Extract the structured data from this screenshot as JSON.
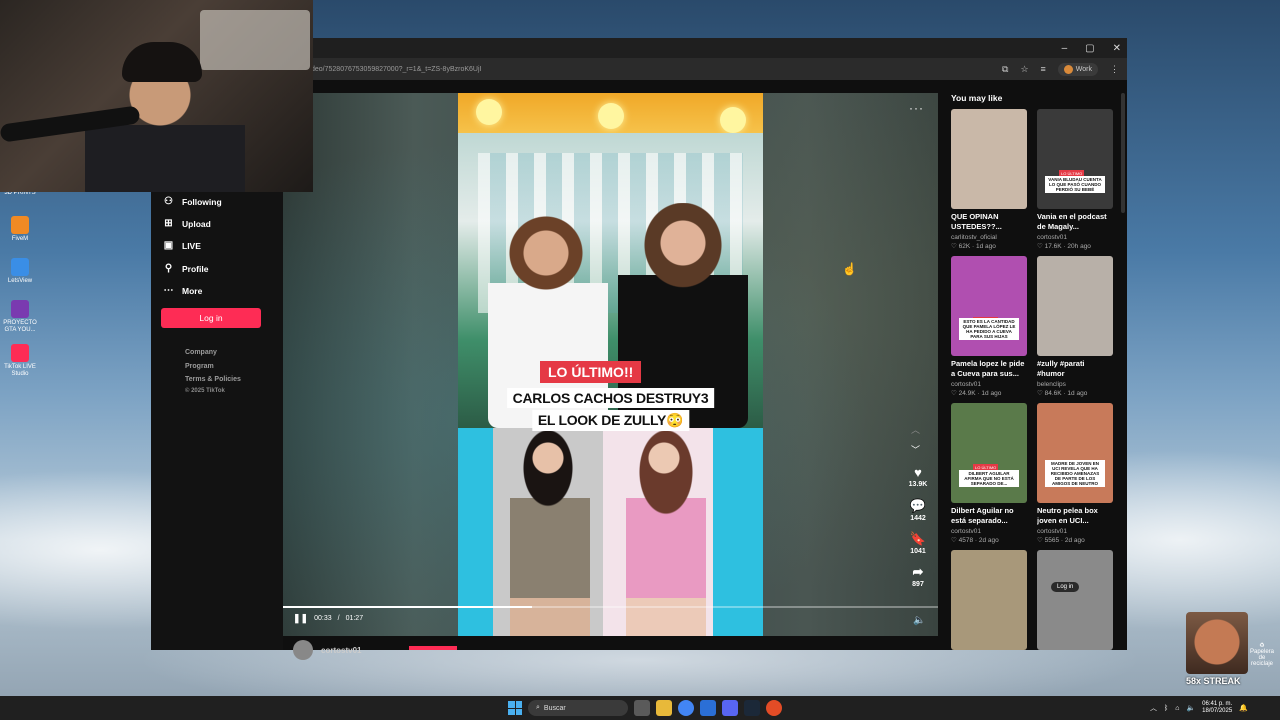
{
  "desktop": {
    "icons": [
      {
        "label": "3D PRINTS",
        "color": "#444444"
      },
      {
        "label": "FiveM",
        "color": "#f08a24"
      },
      {
        "label": "LetsView",
        "color": "#3a8ee6"
      },
      {
        "label": "PROYECTO GTA YOU...",
        "color": "#7a3ab0"
      },
      {
        "label": "TikTok LIVE Studio",
        "color": "#fe2c55"
      }
    ],
    "streak_label": "58x STREAK",
    "recycle_label": "Papelera de reciclaje"
  },
  "browser": {
    "controls": {
      "minimize": "–",
      "maximize": "▢",
      "close": "✕"
    },
    "url": "deo/7528076753059827000?_r=1&_t=ZS-8yBzroK6UjI",
    "profile_label": "Work"
  },
  "sidebar": {
    "nav": [
      {
        "label": "Following",
        "icon": "person-plus-icon",
        "glyph": "👤"
      },
      {
        "label": "Upload",
        "icon": "plus-square-icon",
        "glyph": "⊞"
      },
      {
        "label": "LIVE",
        "icon": "live-tv-icon",
        "glyph": "📺"
      },
      {
        "label": "Profile",
        "icon": "person-icon",
        "glyph": "👤"
      },
      {
        "label": "More",
        "icon": "more-icon",
        "glyph": "⋯"
      }
    ],
    "login_label": "Log in",
    "footer_links": [
      "Company",
      "Program",
      "Terms & Policies"
    ],
    "copyright": "© 2025 TikTok"
  },
  "video": {
    "caption_red": "LO ÚLTIMO!!",
    "caption_line1": "CARLOS CACHOS DESTRUY3",
    "caption_line2": "EL LOOK DE ZULLY😳",
    "likes": "13.9K",
    "comments": "1442",
    "saves": "1041",
    "shares": "897",
    "time_current": "00:33",
    "time_separator": "/",
    "time_total": "01:27",
    "progress": 0.38,
    "author": "cortostv01"
  },
  "recommendations": {
    "title": "You may like",
    "items": [
      {
        "title": "QUE OPINAN USTEDES??...",
        "user": "carlitostv_oficial",
        "likes": "62K",
        "age": "1d ago",
        "bg": "#c9b8a8",
        "tag": ""
      },
      {
        "title": "Vania en el podcast de Magaly...",
        "user": "cortostv01",
        "likes": "17.6K",
        "age": "20h ago",
        "bg": "#3a3a3a",
        "tag": "VANIA BLUDAU CUENTA LO QUE PASÓ CUANDO PERDIÓ SU BEBÉ"
      },
      {
        "title": "Pamela lopez le pide a Cueva para sus...",
        "user": "cortostv01",
        "likes": "24.9K",
        "age": "1d ago",
        "bg": "#b04fb0",
        "tag": "ESTO ES LA CANTIDAD QUE PAMELA LÓPEZ LE HA PEDIDO A CUEVA PARA SUS HIJAS"
      },
      {
        "title": "#zully #parati #humor",
        "user": "belenclips",
        "likes": "84.6K",
        "age": "1d ago",
        "bg": "#b8b0a8",
        "tag": ""
      },
      {
        "title": "Dilbert Aguilar no está separado...",
        "user": "cortostv01",
        "likes": "4578",
        "age": "2d ago",
        "bg": "#5a7a4a",
        "tag": "DILBERT AGUILAR AFIRMA QUE NO ESTÁ SEPARADO DE..."
      },
      {
        "title": "Neutro pelea box joven en UCI...",
        "user": "cortostv01",
        "likes": "5565",
        "age": "2d ago",
        "bg": "#c87a5a",
        "tag": "MADRE DE JOVEN EN UCI REVELA QUE HA RECIBIDO AMENAZAS DE PARTE DE LOS AMIGOS DE NEUTRO"
      },
      {
        "title": "",
        "user": "",
        "likes": "",
        "age": "",
        "bg": "#a8987a",
        "tag": ""
      },
      {
        "title": "",
        "user": "",
        "likes": "",
        "age": "",
        "bg": "#8a8a8a",
        "tag": ""
      }
    ],
    "thumb_login_label": "Log in",
    "thumb_red_label": "LO ÚLTIMO"
  },
  "taskbar": {
    "search_placeholder": "Buscar",
    "time": "06:41 p. m.",
    "date": "18/07/2025"
  }
}
